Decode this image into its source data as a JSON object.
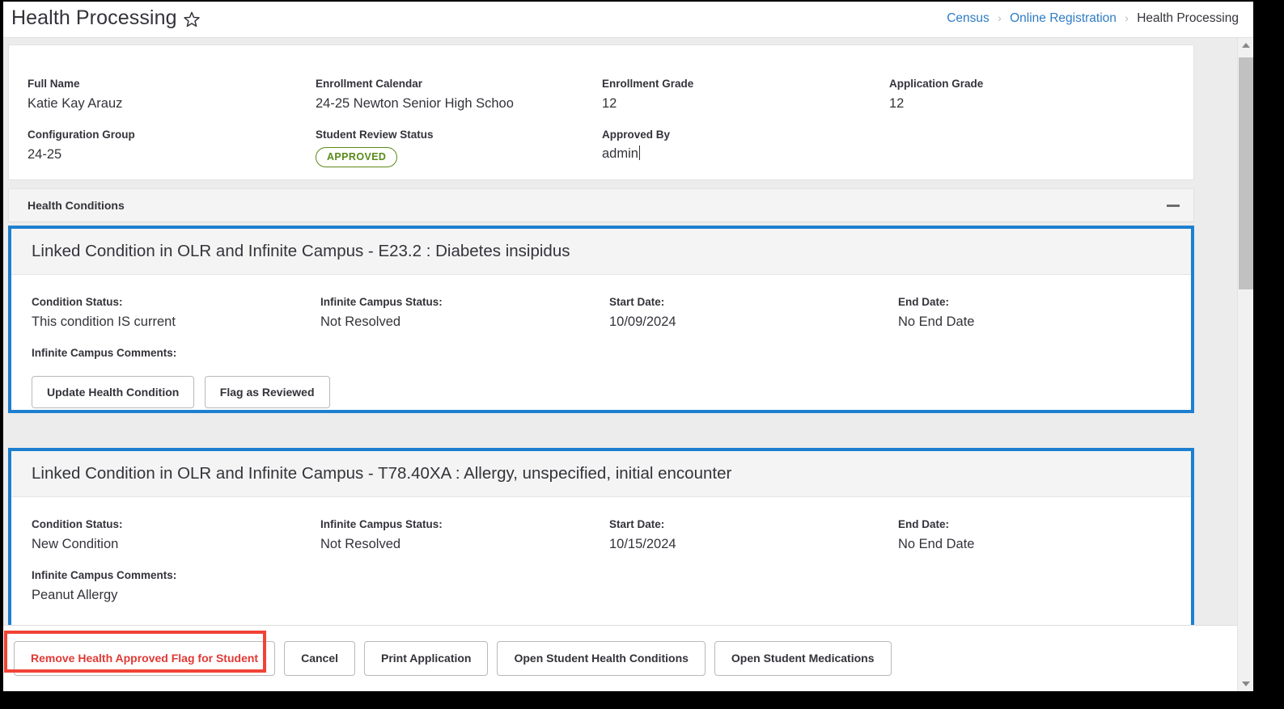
{
  "header": {
    "title": "Health Processing",
    "favorite_icon": "star-icon",
    "breadcrumb": [
      {
        "label": "Census",
        "link": true
      },
      {
        "label": "Online Registration",
        "link": true
      },
      {
        "label": "Health Processing",
        "link": false
      }
    ],
    "breadcrumb_separator": "›"
  },
  "info": {
    "fields": [
      {
        "label": "Full Name",
        "value": "Katie Kay Arauz"
      },
      {
        "label": "Enrollment Calendar",
        "value": "24-25 Newton Senior High Schoo"
      },
      {
        "label": "Enrollment Grade",
        "value": "12"
      },
      {
        "label": "Application Grade",
        "value": "12"
      },
      {
        "label": "Configuration Group",
        "value": "24-25"
      },
      {
        "label": "Student Review Status",
        "value": "APPROVED"
      },
      {
        "label": "Approved By",
        "value": "admin"
      }
    ],
    "status_badge": {
      "text": "APPROVED",
      "color": "#5a8a18"
    },
    "approved_by_placeholder": ""
  },
  "section": {
    "title": "Health Conditions",
    "collapse_icon": "minus-icon"
  },
  "conditions": [
    {
      "title": "Linked Condition in OLR and Infinite Campus - E23.2 : Diabetes insipidus",
      "fields": [
        {
          "label": "Condition Status:",
          "value": "This condition IS current"
        },
        {
          "label": "Infinite Campus Status:",
          "value": "Not Resolved"
        },
        {
          "label": "Start Date:",
          "value": "10/09/2024"
        },
        {
          "label": "End Date:",
          "value": "No End Date"
        }
      ],
      "comments_label": "Infinite Campus Comments:",
      "comments_value": "",
      "buttons": [
        {
          "label": "Update Health Condition"
        },
        {
          "label": "Flag as Reviewed"
        }
      ]
    },
    {
      "title": "Linked Condition in OLR and Infinite Campus - T78.40XA : Allergy, unspecified, initial encounter",
      "fields": [
        {
          "label": "Condition Status:",
          "value": "New Condition"
        },
        {
          "label": "Infinite Campus Status:",
          "value": "Not Resolved"
        },
        {
          "label": "Start Date:",
          "value": "10/15/2024"
        },
        {
          "label": "End Date:",
          "value": "No End Date"
        }
      ],
      "comments_label": "Infinite Campus Comments:",
      "comments_value": "Peanut Allergy",
      "buttons": []
    }
  ],
  "toolbar": {
    "buttons": [
      {
        "label": "Remove Health Approved Flag for Student",
        "style": "danger"
      },
      {
        "label": "Cancel",
        "style": "default"
      },
      {
        "label": "Print Application",
        "style": "default"
      },
      {
        "label": "Open Student Health Conditions",
        "style": "default"
      },
      {
        "label": "Open Student Medications",
        "style": "default"
      }
    ]
  },
  "annotation": {
    "highlight_color": "#f04336",
    "highlight_target": "Remove Health Approved Flag for Student"
  },
  "colors": {
    "card_border_blue": "#1c7fd0",
    "link_blue": "#2e7cc4",
    "approved_green": "#5a8a18",
    "danger_red": "#e03a35"
  },
  "scrollbar": {
    "up_arrow": "arrow-up-icon",
    "down_arrow": "arrow-down-icon"
  }
}
